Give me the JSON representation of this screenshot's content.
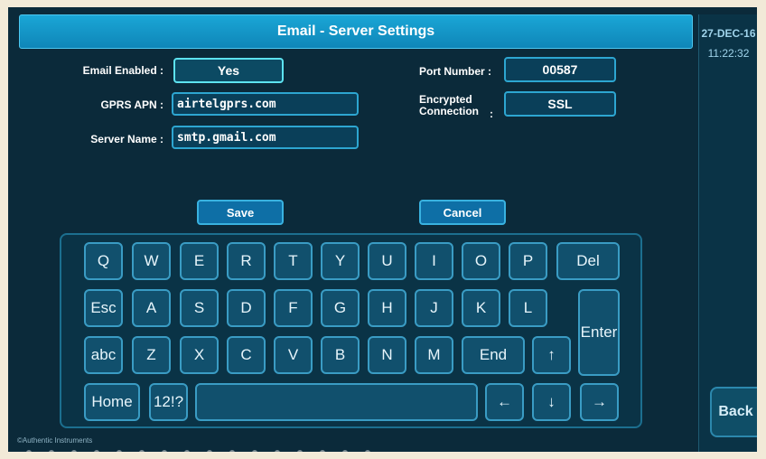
{
  "header": {
    "title": "Email - Server Settings"
  },
  "status": {
    "date": "27-DEC-16",
    "time": "11:22:32"
  },
  "form": {
    "email_enabled_label": "Email Enabled :",
    "email_enabled_value": "Yes",
    "gprs_apn_label": "GPRS APN :",
    "gprs_apn_value": "airtelgprs.com",
    "server_name_label": "Server Name :",
    "server_name_value": "smtp.gmail.com",
    "port_number_label": "Port Number :",
    "port_number_value": "00587",
    "encrypted_label_line1": "Encrypted",
    "encrypted_label_line2": "Connection",
    "encrypted_colon": ":",
    "encrypted_value": "SSL"
  },
  "actions": {
    "save": "Save",
    "cancel": "Cancel",
    "back": "Back"
  },
  "keyboard": {
    "row1": [
      "Q",
      "W",
      "E",
      "R",
      "T",
      "Y",
      "U",
      "I",
      "O",
      "P"
    ],
    "del": "Del",
    "esc": "Esc",
    "row2": [
      "A",
      "S",
      "D",
      "F",
      "G",
      "H",
      "J",
      "K",
      "L"
    ],
    "enter": "Enter",
    "abc": "abc",
    "row3": [
      "Z",
      "X",
      "C",
      "V",
      "B",
      "N",
      "M"
    ],
    "end": "End",
    "up": "↑",
    "home": "Home",
    "sym": "12!?",
    "left": "←",
    "down": "↓",
    "right": "→"
  },
  "footer": {
    "copyright": "©Authentic Instruments"
  }
}
